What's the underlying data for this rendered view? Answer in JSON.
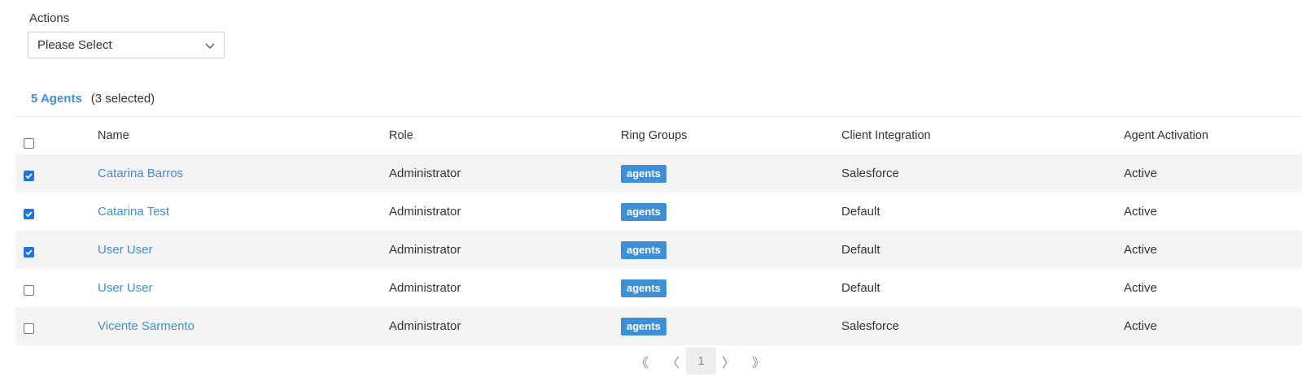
{
  "actions": {
    "label": "Actions",
    "select_value": "Please Select"
  },
  "summary": {
    "count_label": "5 Agents",
    "selected_label": "(3 selected)"
  },
  "columns": {
    "name": "Name",
    "role": "Role",
    "ring_groups": "Ring Groups",
    "client_integration": "Client Integration",
    "agent_activation": "Agent Activation"
  },
  "header_checkbox_checked": false,
  "rows": [
    {
      "checked": true,
      "name": "Catarina Barros",
      "role": "Administrator",
      "ring_group": "agents",
      "client_integration": "Salesforce",
      "activation": "Active"
    },
    {
      "checked": true,
      "name": "Catarina Test",
      "role": "Administrator",
      "ring_group": "agents",
      "client_integration": "Default",
      "activation": "Active"
    },
    {
      "checked": true,
      "name": "User User",
      "role": "Administrator",
      "ring_group": "agents",
      "client_integration": "Default",
      "activation": "Active"
    },
    {
      "checked": false,
      "name": "User User",
      "role": "Administrator",
      "ring_group": "agents",
      "client_integration": "Default",
      "activation": "Active"
    },
    {
      "checked": false,
      "name": "Vicente Sarmento",
      "role": "Administrator",
      "ring_group": "agents",
      "client_integration": "Salesforce",
      "activation": "Active"
    }
  ],
  "pagination": {
    "first": "《",
    "prev": "〈",
    "current_page": "1",
    "next": "〉",
    "last": "》"
  },
  "colors": {
    "accent": "#3d8fd7",
    "checkbox": "#1a73e8",
    "row_stripe": "#f4f4f4"
  }
}
